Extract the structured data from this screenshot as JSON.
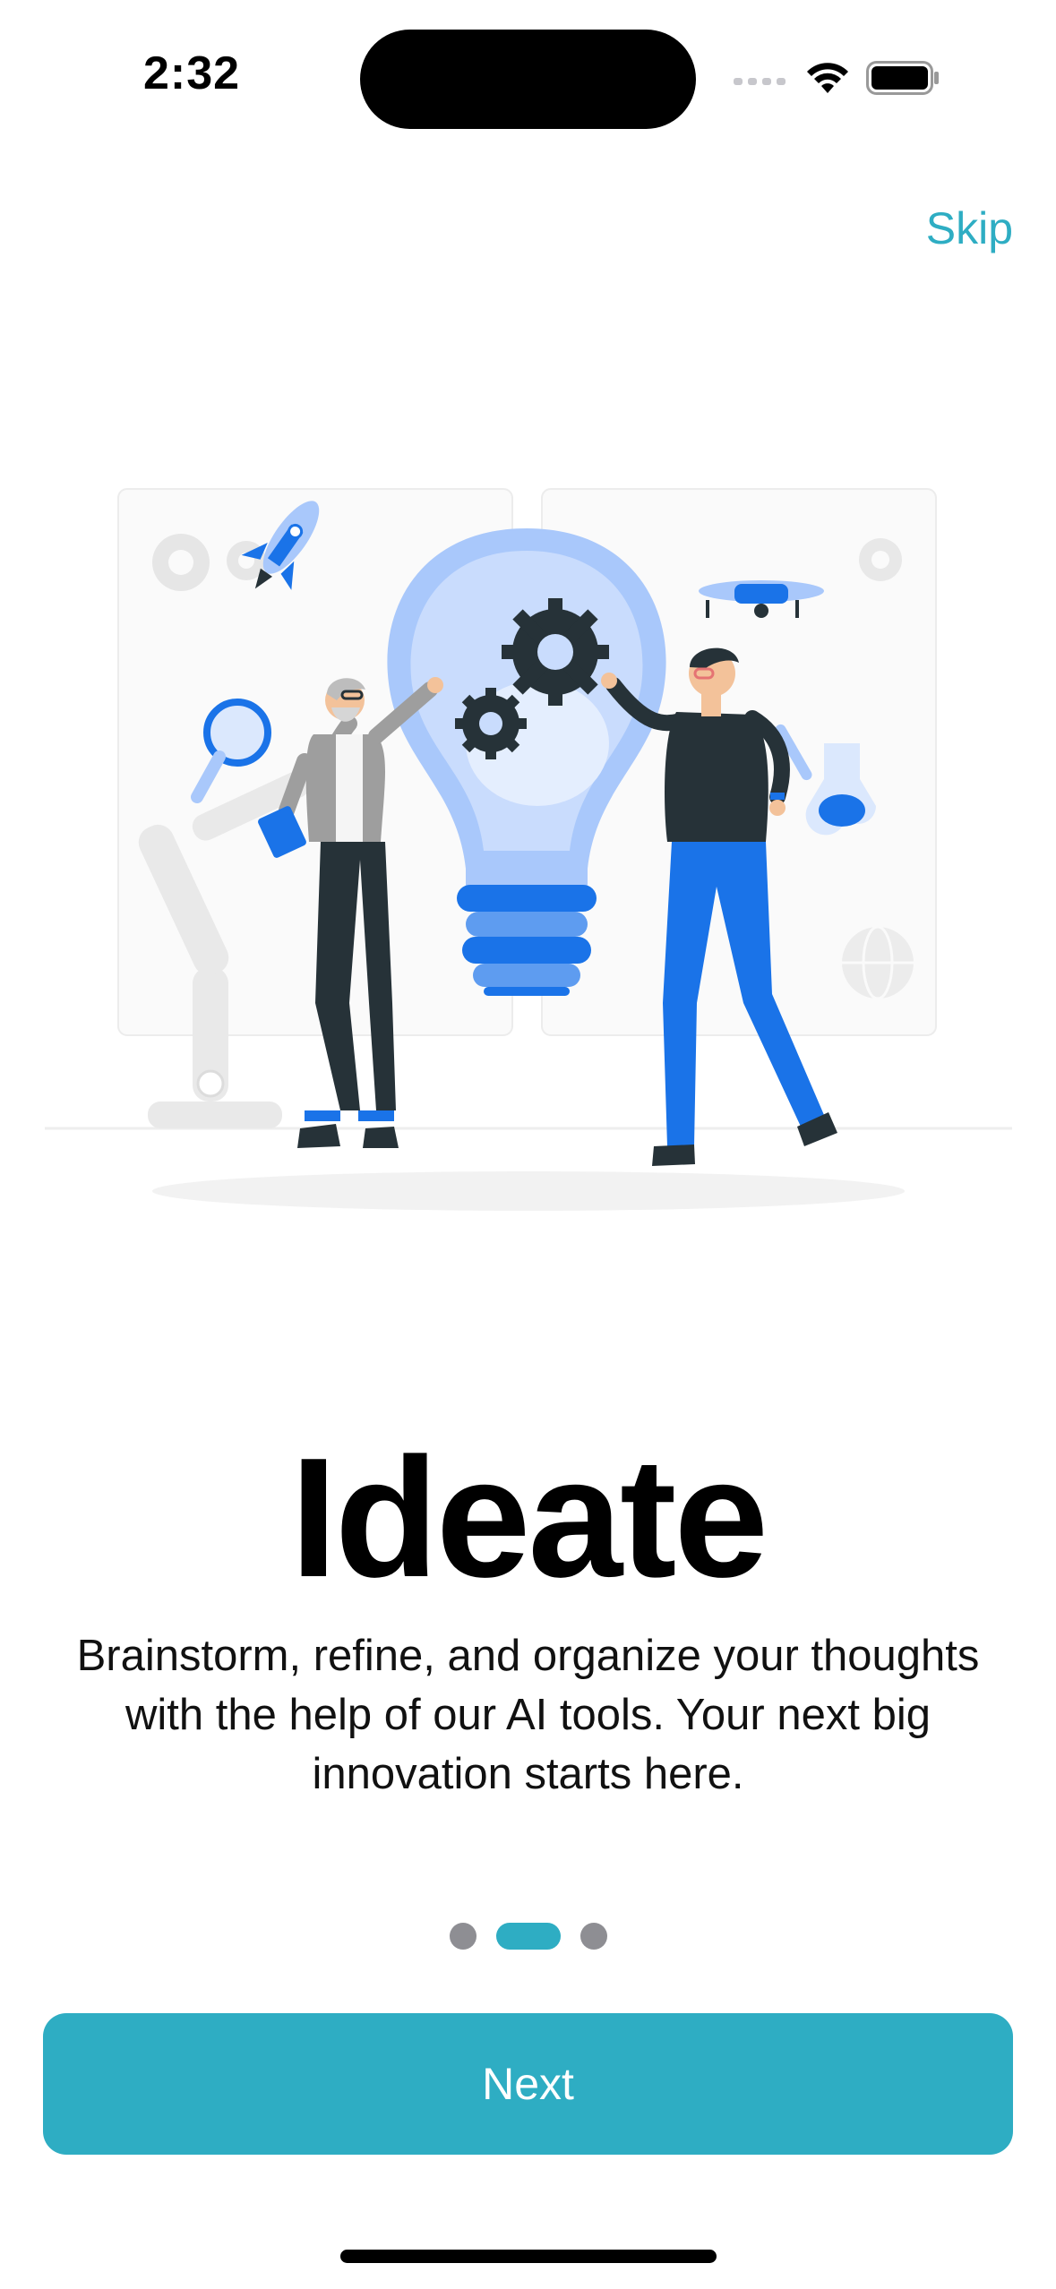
{
  "status_bar": {
    "time": "2:32"
  },
  "header": {
    "skip_label": "Skip"
  },
  "onboarding": {
    "title": "Ideate",
    "description": "Brainstorm, refine, and organize your thoughts with the help of our AI tools. Your next big innovation starts here.",
    "page_count": 3,
    "current_page": 2
  },
  "footer": {
    "next_label": "Next"
  },
  "colors": {
    "accent": "#2EADC3",
    "inactive_dot": "#8E8E93",
    "illustration_blue": "#1A73E8",
    "illustration_light_blue": "#A9C8FB",
    "illustration_dark": "#263238"
  },
  "icons": [
    "signal-icon",
    "wifi-icon",
    "battery-icon"
  ]
}
